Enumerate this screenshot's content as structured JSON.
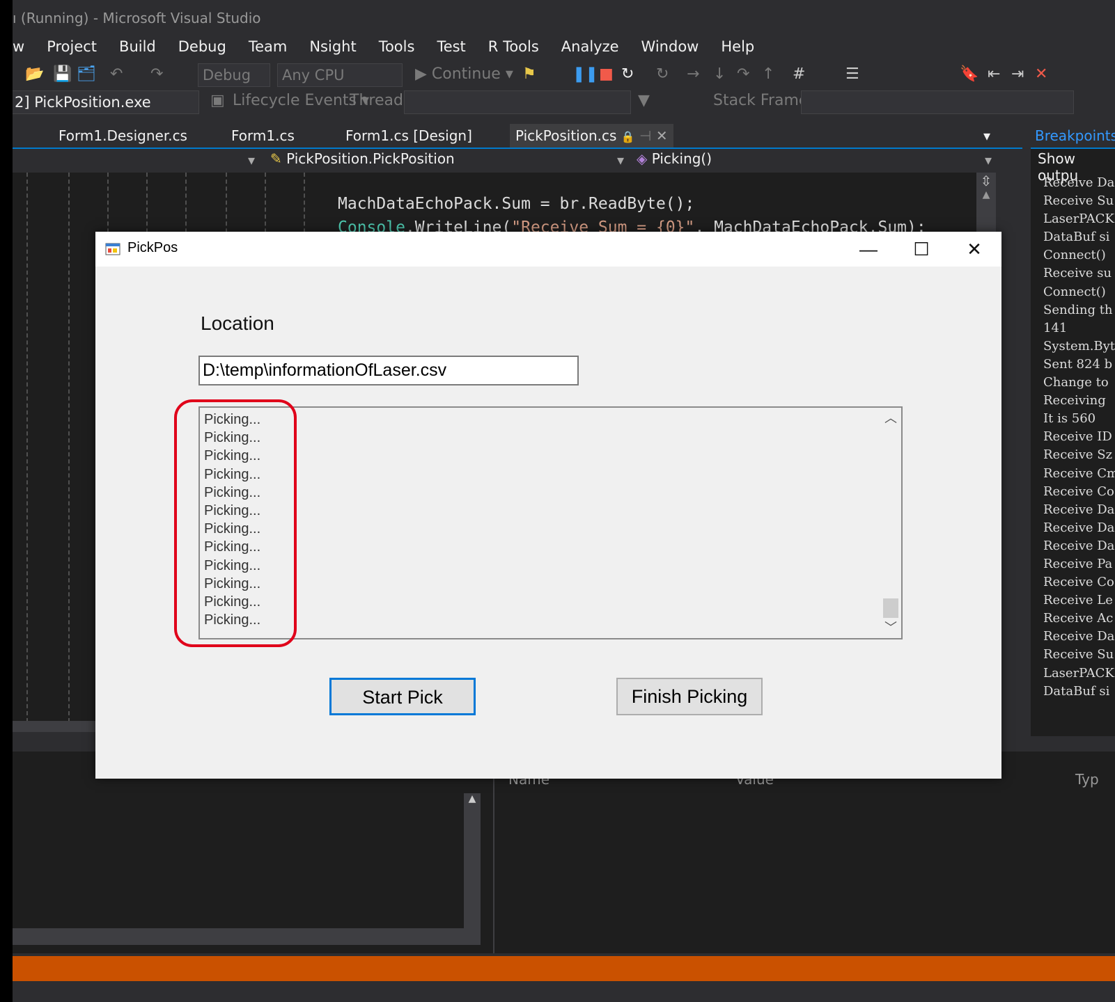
{
  "ide": {
    "title": "ı (Running) - Microsoft Visual Studio",
    "menu": [
      "w",
      "Project",
      "Build",
      "Debug",
      "Team",
      "Nsight",
      "Tools",
      "Test",
      "R Tools",
      "Analyze",
      "Window",
      "Help"
    ],
    "toolbar": {
      "config": "Debug",
      "platform": "Any CPU",
      "continue": "▶ Continue ▾"
    },
    "toolbar2": {
      "process": "2] PickPosition.exe",
      "lifecycle": "Lifecycle Events ▾",
      "thread": "Thread:",
      "stack_frame": "Stack Frame:"
    },
    "tabs": [
      "Form1.Designer.cs",
      "Form1.cs",
      "Form1.cs [Design]",
      "PickPosition.cs"
    ],
    "nav": {
      "class": "PickPosition.PickPosition",
      "method": "Picking()"
    },
    "code": {
      "line1": "MachDataEchoPack.Sum = br.ReadByte();",
      "line2_a": "Console",
      "line2_b": ".WriteLine(",
      "line2_c": "\"Receive Sum = {0}\"",
      "line2_d": ", MachDataEchoPack.Sum);"
    },
    "breakpoints": {
      "header": "Breakpoints",
      "show_output": "Show outpu",
      "output": "Receive Da\nReceive Su\nLaserPACKE\nDataBuf si\nConnect()\nReceive su\nConnect()\nSending th\n141\nSystem.Byt\nSent 824 b\nChange to\nReceiving\nIt is 560\nReceive ID\nReceive Sz\nReceive Cm\nReceive Co\nReceive Da\nReceive Da\nReceive Da\nReceive Pa\nReceive Co\nReceive Le\nReceive Ac\nReceive Da\nReceive Su\nLaserPACKE\nDataBuf si"
    },
    "bottom": {
      "col_name": "Name",
      "col_value": "Value",
      "col_type": "Typ"
    },
    "colors": {
      "status_bar": "#ca5100",
      "accent": "#007acc",
      "bg": "#2d2d30"
    }
  },
  "dialog": {
    "title": "PickPos",
    "location_label": "Location",
    "path": "D:\\temp\\informationOfLaser.csv",
    "log_items": [
      "Picking...",
      "Picking...",
      "Picking...",
      "Picking...",
      "Picking...",
      "Picking...",
      "Picking...",
      "Picking...",
      "Picking...",
      "Picking...",
      "Picking...",
      "Picking..."
    ],
    "start_button": "Start Pick",
    "finish_button": "Finish Picking",
    "highlight_color": "#e0001a"
  }
}
